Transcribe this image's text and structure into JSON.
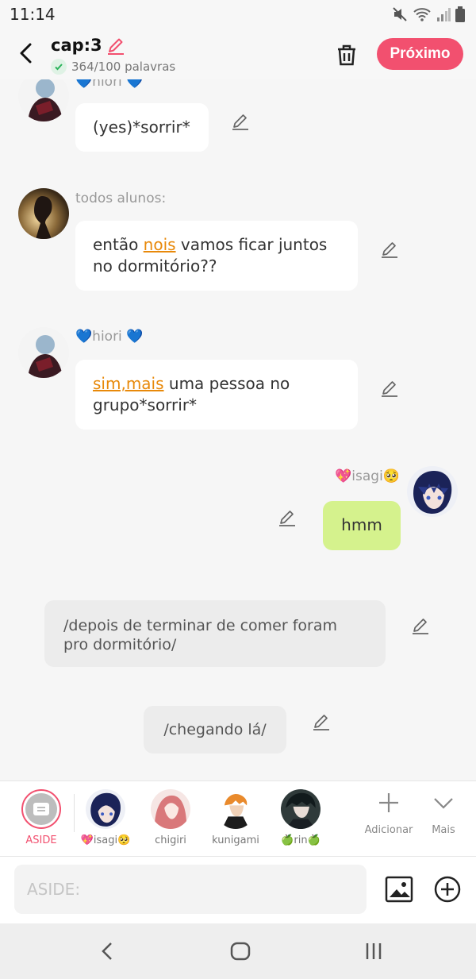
{
  "status": {
    "time": "11:14"
  },
  "header": {
    "title": "cap:3",
    "word_count": "364/100 palavras",
    "next_label": "Próximo"
  },
  "messages": [
    {
      "name": "💙hiori 💙",
      "text": "(yes)*sorrir*"
    },
    {
      "name": "todos alunos:",
      "pre": "então ",
      "hl": "nois",
      "post": " vamos ficar juntos no dormitório??"
    },
    {
      "name": "💙hiori 💙",
      "hl": "sim,mais",
      "post": " uma pessoa no grupo*sorrir*"
    },
    {
      "name": "💖isagi🥺",
      "text": "hmm"
    },
    {
      "text": "/depois de terminar de comer foram pro dormitório/"
    },
    {
      "text": "/chegando lá/"
    }
  ],
  "characters": [
    {
      "label": "ASIDE"
    },
    {
      "label": "💖isagi🥺"
    },
    {
      "label": "chigiri"
    },
    {
      "label": "kunigami"
    },
    {
      "label": "🍏rin🍏"
    }
  ],
  "tools": {
    "add_label": "Adicionar",
    "more_label": "Mais"
  },
  "input": {
    "placeholder": "ASIDE:"
  },
  "colors": {
    "accent": "#f2506f",
    "green_bubble": "#d5f28d",
    "highlight": "#e8890a"
  }
}
